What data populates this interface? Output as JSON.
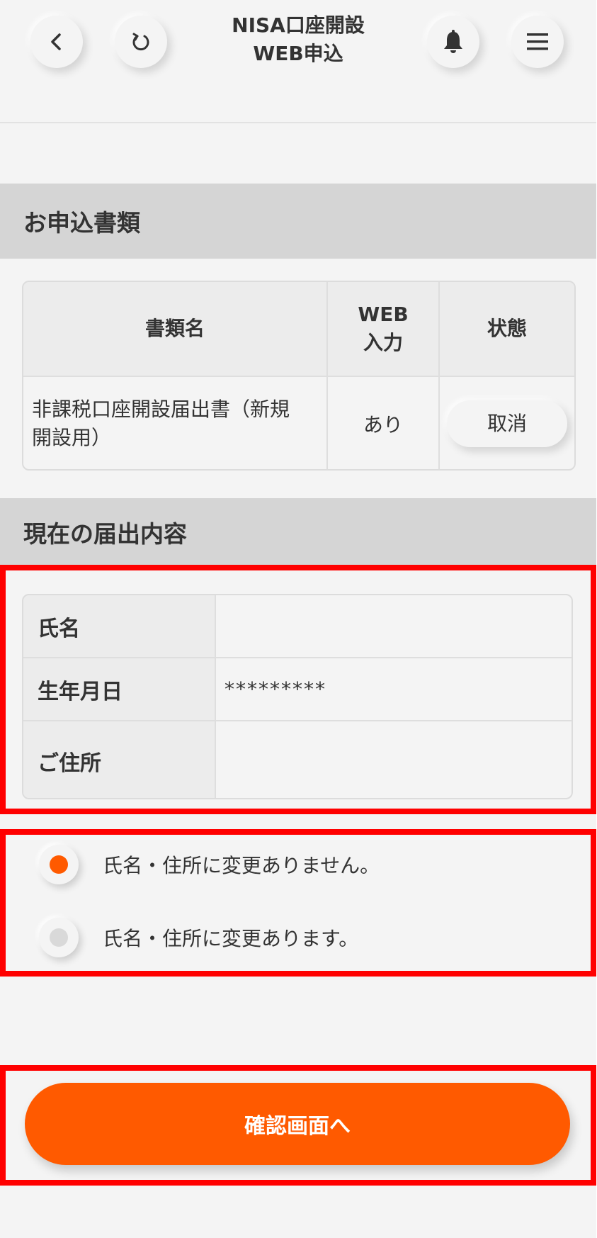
{
  "header": {
    "title_line1": "NISA口座開設",
    "title_line2": "WEB申込",
    "back_icon": "chevron-left-icon",
    "reload_icon": "reload-icon",
    "bell_icon": "bell-icon",
    "menu_icon": "hamburger-menu-icon"
  },
  "documents": {
    "section_title": "お申込書類",
    "columns": [
      "書類名",
      "WEB\n入力",
      "状態"
    ],
    "col_name": "書類名",
    "col_web_line1": "WEB",
    "col_web_line2": "入力",
    "col_status": "状態",
    "rows": [
      {
        "name_line1": "非課税口座開設届出書（新規",
        "name_line2": "開設用）",
        "web_input": "あり",
        "action": "取消"
      }
    ]
  },
  "current_info": {
    "section_title": "現在の届出内容",
    "name_label": "氏名",
    "name_value": "",
    "birthday_label": "生年月日",
    "birthday_value": "*********",
    "address_label": "ご住所",
    "address_value": ""
  },
  "change_options": {
    "selected_index": 0,
    "options": [
      "氏名・住所に変更ありません。",
      "氏名・住所に変更あります。"
    ]
  },
  "actions": {
    "confirm_label": "確認画面へ"
  },
  "colors": {
    "accent": "#ff5a00",
    "background": "#f4f4f4",
    "section_header": "#d5d5d5",
    "highlight": "#ff0000"
  }
}
